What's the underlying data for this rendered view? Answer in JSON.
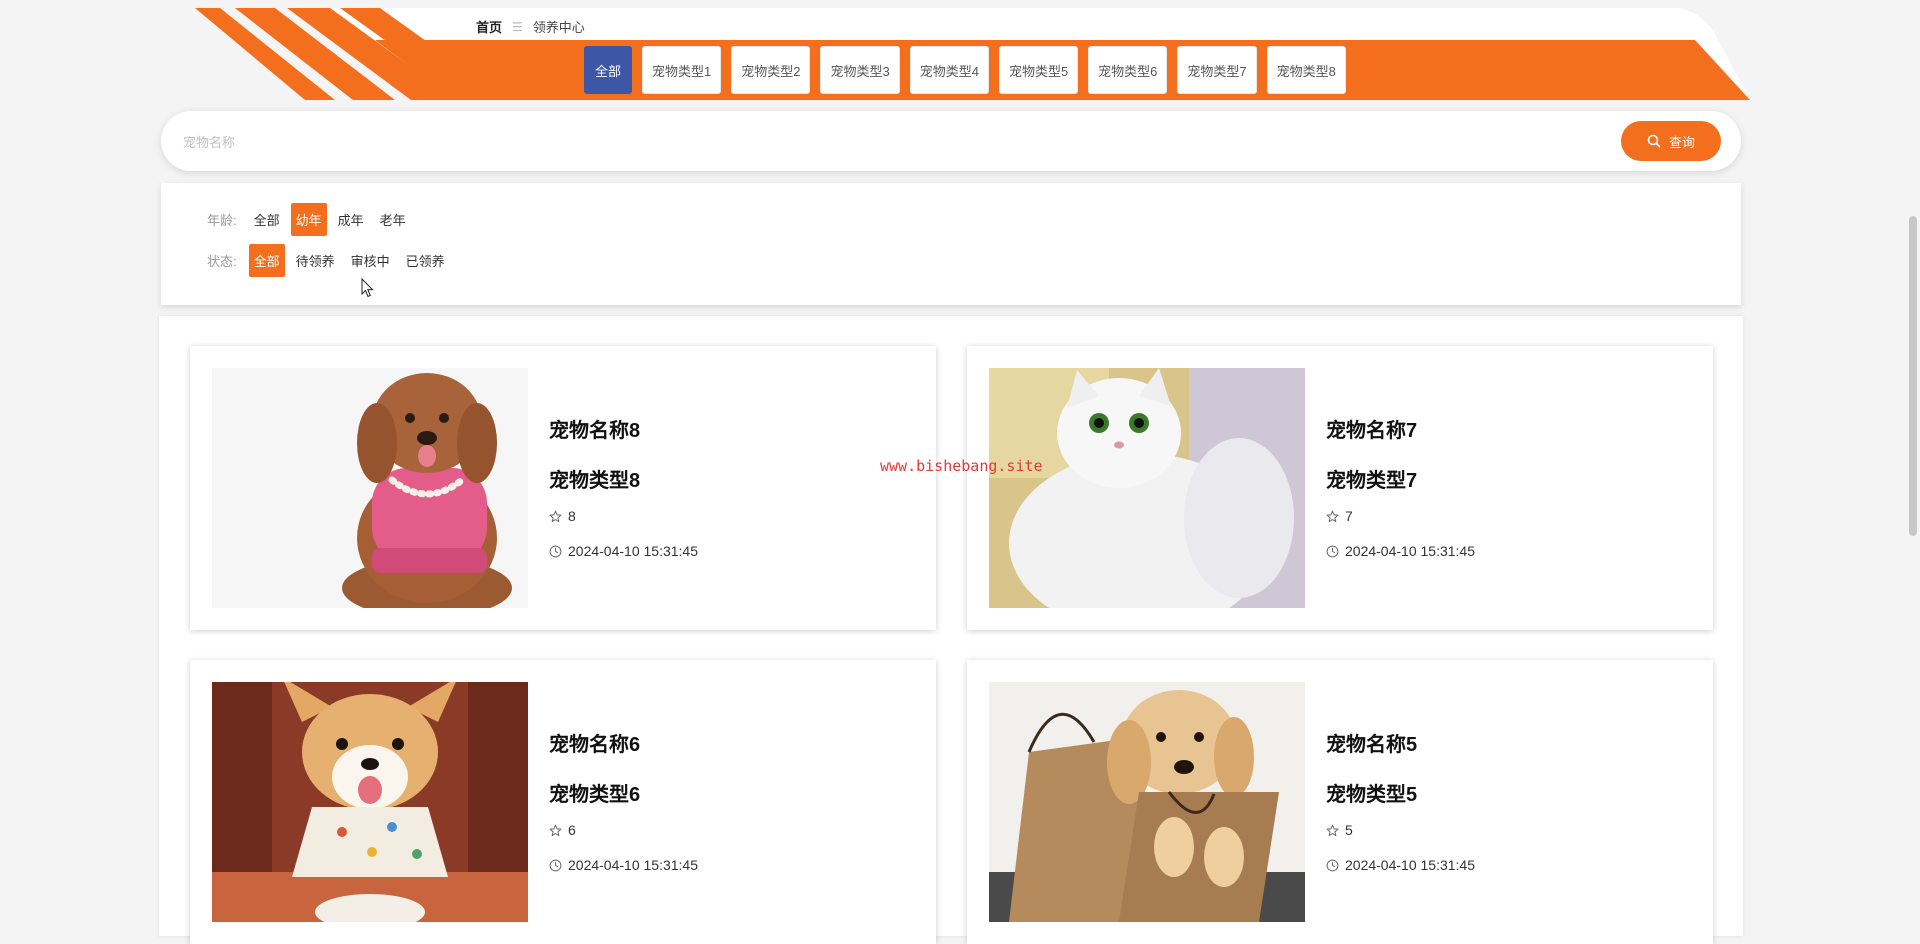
{
  "breadcrumb": {
    "home": "首页",
    "separator": "☰",
    "current": "领养中心"
  },
  "type_tabs": [
    {
      "label": "全部",
      "active": true
    },
    {
      "label": "宠物类型1",
      "active": false
    },
    {
      "label": "宠物类型2",
      "active": false
    },
    {
      "label": "宠物类型3",
      "active": false
    },
    {
      "label": "宠物类型4",
      "active": false
    },
    {
      "label": "宠物类型5",
      "active": false
    },
    {
      "label": "宠物类型6",
      "active": false
    },
    {
      "label": "宠物类型7",
      "active": false
    },
    {
      "label": "宠物类型8",
      "active": false
    }
  ],
  "search": {
    "placeholder": "宠物名称",
    "value": "",
    "button_label": "查询",
    "button_icon": "search-icon"
  },
  "filters": {
    "age": {
      "label": "年龄:",
      "options": [
        "全部",
        "幼年",
        "成年",
        "老年"
      ],
      "selected": "幼年"
    },
    "status": {
      "label": "状态:",
      "options": [
        "全部",
        "待领养",
        "审核中",
        "已领养"
      ],
      "selected": "全部"
    }
  },
  "pets": [
    {
      "name": "宠物名称8",
      "type": "宠物类型8",
      "likes": "8",
      "time": "2024-04-10 15:31:45",
      "photo": "brown-poodle-in-pink-sweater"
    },
    {
      "name": "宠物名称7",
      "type": "宠物类型7",
      "likes": "7",
      "time": "2024-04-10 15:31:45",
      "photo": "white-fluffy-cat"
    },
    {
      "name": "宠物名称6",
      "type": "宠物类型6",
      "likes": "6",
      "time": "2024-04-10 15:31:45",
      "photo": "corgi-with-bib"
    },
    {
      "name": "宠物名称5",
      "type": "宠物类型5",
      "likes": "5",
      "time": "2024-04-10 15:31:45",
      "photo": "golden-puppy-in-paper-bag"
    }
  ],
  "watermark": "www.bishebang.site",
  "colors": {
    "accent": "#f36f1e",
    "active_tab": "#3d56a6",
    "watermark": "#e53935",
    "background": "#f4f4f4"
  },
  "icons": {
    "likes": "star-icon",
    "time": "clock-icon"
  }
}
